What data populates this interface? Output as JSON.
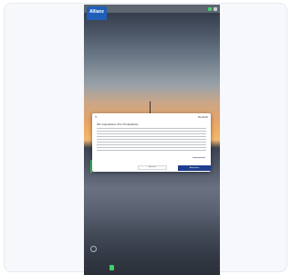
{
  "app": {
    "logo_text": "Allianz",
    "accent_color": "#1f5fb8"
  },
  "status_bar": {
    "icons": [
      "battery-icon",
      "signal-icon"
    ]
  },
  "dialog": {
    "close_icon": "×",
    "language": "Deutsch",
    "title": "Wir respektieren Ihre Privatsphäre",
    "decline_label": "Ablehnen",
    "accept_label": "Akzeptieren",
    "primary_color": "#1e3f8f"
  }
}
